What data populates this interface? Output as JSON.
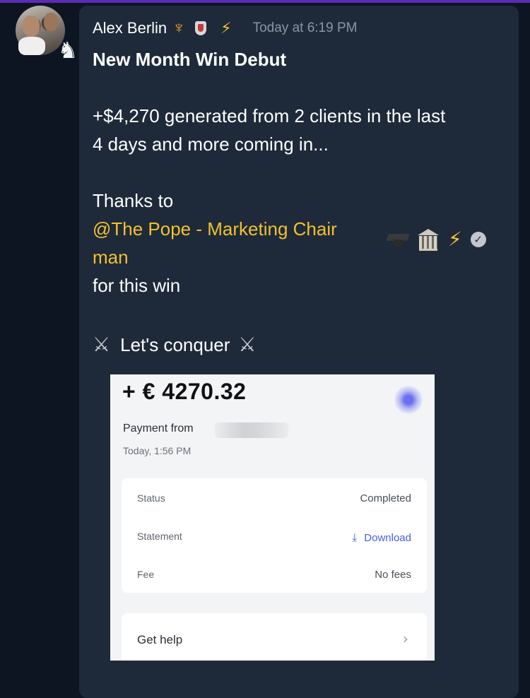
{
  "message": {
    "author": "Alex Berlin",
    "timestamp": "Today at 6:19 PM",
    "title": "New Month Win Debut",
    "body_line1": "+$4,270 generated from 2 clients in the last",
    "body_line2": "4 days and more coming in...",
    "thanks": "Thanks to",
    "mention_part1": "@The Pope - Marketing Chair",
    "mention_part2": "man",
    "for_win": "for this win",
    "closing": "Let's conquer"
  },
  "icons": {
    "author_badges": [
      "trident-icon",
      "shield-icon",
      "bolt-icon"
    ],
    "mention_badges": [
      "graduation-cap-icon",
      "bank-icon",
      "bolt-icon",
      "verified-icon"
    ],
    "closing": [
      "crossed-swords-icon",
      "crossed-swords-icon"
    ]
  },
  "receipt": {
    "amount": "+ € 4270.32",
    "payment_from": "Payment from",
    "time": "Today, 1:56 PM",
    "rows": [
      {
        "label": "Status",
        "value": "Completed"
      },
      {
        "label": "Statement",
        "value": "Download"
      },
      {
        "label": "Fee",
        "value": "No fees"
      }
    ],
    "help": "Get help"
  },
  "colors": {
    "background": "#0d1523",
    "bubble": "#1e2a3a",
    "mention": "#f2c12e",
    "accent_bar": "#5b2bb5",
    "download_link": "#4a5de0"
  }
}
